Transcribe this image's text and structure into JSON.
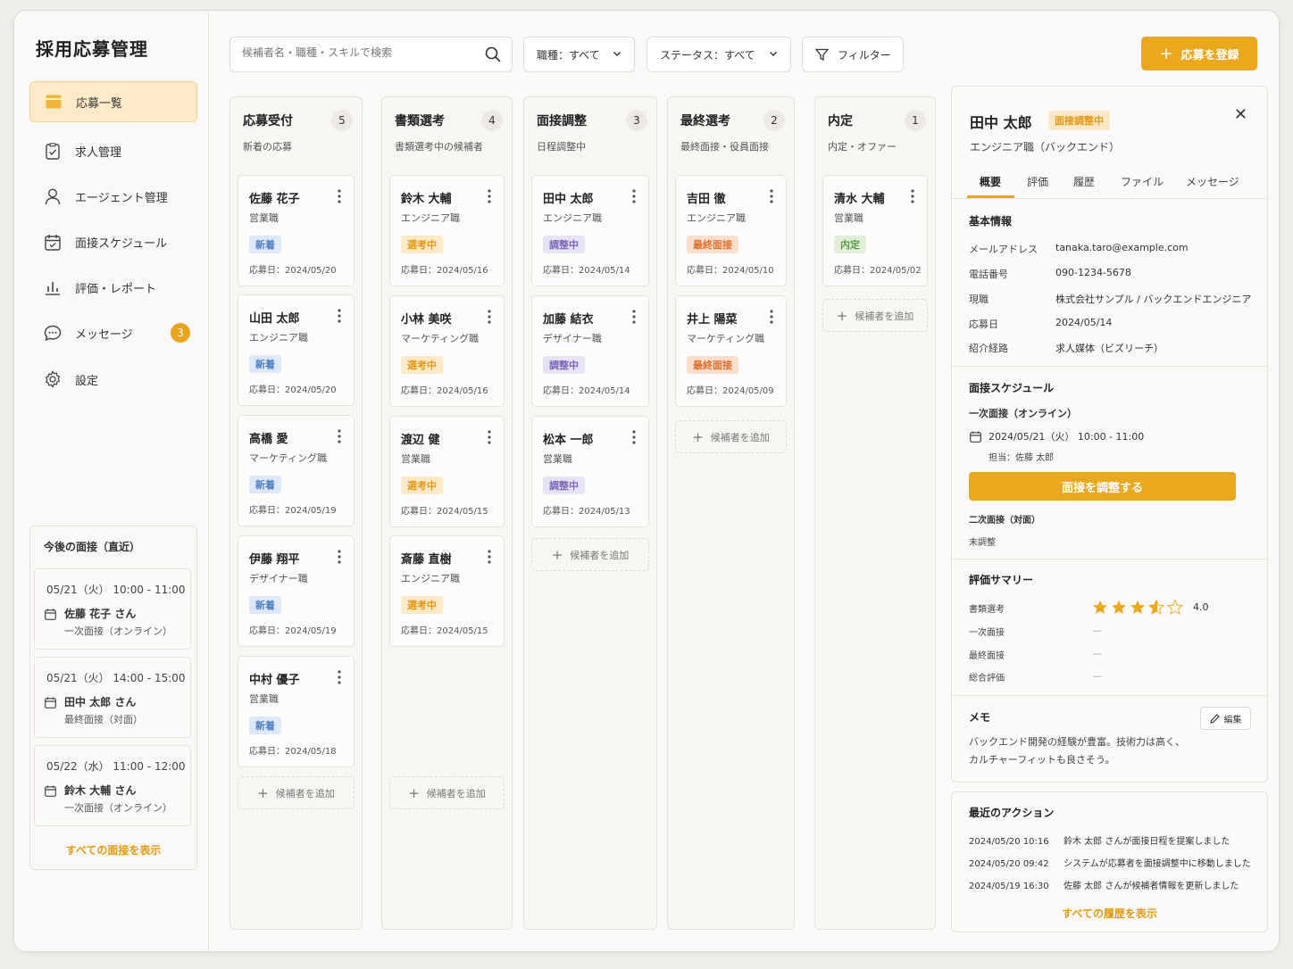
{
  "app": {
    "title": "採用応募管理"
  },
  "sidebar": {
    "items": [
      {
        "label": "応募一覧",
        "icon": "inbox-icon"
      },
      {
        "label": "求人管理",
        "icon": "clipboard-check-icon"
      },
      {
        "label": "エージェント管理",
        "icon": "user-icon"
      },
      {
        "label": "面接スケジュール",
        "icon": "calendar-check-icon"
      },
      {
        "label": "評価・レポート",
        "icon": "bar-chart-icon"
      },
      {
        "label": "メッセージ",
        "icon": "chat-icon",
        "badge": "3"
      },
      {
        "label": "設定",
        "icon": "gear-icon"
      }
    ],
    "upcoming": {
      "title": "今後の面接（直近）",
      "items": [
        {
          "time": "05/21（火） 10:00 - 11:00",
          "name": "佐藤 花子 さん",
          "type": "一次面接（オンライン）"
        },
        {
          "time": "05/21（火） 14:00 - 15:00",
          "name": "田中 太郎 さん",
          "type": "最終面接（対面）"
        },
        {
          "time": "05/22（水） 11:00 - 12:00",
          "name": "鈴木 大輔 さん",
          "type": "一次面接（オンライン）"
        }
      ],
      "link": "すべての面接を表示"
    }
  },
  "toolbar": {
    "search_placeholder": "候補者名・職種・スキルで検索",
    "job_filter": "職種：すべて",
    "status_filter": "ステータス：すべて",
    "filter_label": "フィルター",
    "add_label": "応募を登録"
  },
  "board": {
    "add_candidate": "候補者を追加",
    "columns": [
      {
        "title": "応募受付",
        "count": "5",
        "subtitle": "新着の応募",
        "cards": [
          {
            "name": "佐藤 花子",
            "role": "営業職",
            "tag": "新着",
            "tag_type": "new",
            "date": "応募日：2024/05/20"
          },
          {
            "name": "山田 太郎",
            "role": "エンジニア職",
            "tag": "新着",
            "tag_type": "new",
            "date": "応募日：2024/05/20"
          },
          {
            "name": "高橋 愛",
            "role": "マーケティング職",
            "tag": "新着",
            "tag_type": "new",
            "date": "応募日：2024/05/19"
          },
          {
            "name": "伊藤 翔平",
            "role": "デザイナー職",
            "tag": "新着",
            "tag_type": "new",
            "date": "応募日：2024/05/19"
          },
          {
            "name": "中村 優子",
            "role": "営業職",
            "tag": "新着",
            "tag_type": "new",
            "date": "応募日：2024/05/18"
          }
        ]
      },
      {
        "title": "書類選考",
        "count": "4",
        "subtitle": "書類選考中の候補者",
        "cards": [
          {
            "name": "鈴木 大輔",
            "role": "エンジニア職",
            "tag": "選考中",
            "tag_type": "sel",
            "date": "応募日：2024/05/16"
          },
          {
            "name": "小林 美咲",
            "role": "マーケティング職",
            "tag": "選考中",
            "tag_type": "sel",
            "date": "応募日：2024/05/16"
          },
          {
            "name": "渡辺 健",
            "role": "営業職",
            "tag": "選考中",
            "tag_type": "sel",
            "date": "応募日：2024/05/15"
          },
          {
            "name": "斎藤 直樹",
            "role": "エンジニア職",
            "tag": "選考中",
            "tag_type": "sel",
            "date": "応募日：2024/05/15"
          }
        ]
      },
      {
        "title": "面接調整",
        "count": "3",
        "subtitle": "日程調整中",
        "cards": [
          {
            "name": "田中 太郎",
            "role": "エンジニア職",
            "tag": "調整中",
            "tag_type": "adj",
            "date": "応募日：2024/05/14"
          },
          {
            "name": "加藤 結衣",
            "role": "デザイナー職",
            "tag": "調整中",
            "tag_type": "adj",
            "date": "応募日：2024/05/14"
          },
          {
            "name": "松本 一郎",
            "role": "営業職",
            "tag": "調整中",
            "tag_type": "adj",
            "date": "応募日：2024/05/13"
          }
        ]
      },
      {
        "title": "最終選考",
        "count": "2",
        "subtitle": "最終面接・役員面接",
        "cards": [
          {
            "name": "吉田 徹",
            "role": "エンジニア職",
            "tag": "最終面接",
            "tag_type": "fin",
            "date": "応募日：2024/05/10"
          },
          {
            "name": "井上 陽菜",
            "role": "マーケティング職",
            "tag": "最終面接",
            "tag_type": "fin",
            "date": "応募日：2024/05/09"
          }
        ]
      },
      {
        "title": "内定",
        "count": "1",
        "subtitle": "内定・オファー",
        "cards": [
          {
            "name": "清水 大輔",
            "role": "営業職",
            "tag": "内定",
            "tag_type": "off",
            "date": "応募日：2024/05/02"
          }
        ]
      }
    ]
  },
  "detail": {
    "name": "田中 太郎",
    "badge": "面接調整中",
    "role": "エンジニア職（バックエンド）",
    "tabs": [
      "概要",
      "評価",
      "履歴",
      "ファイル",
      "メッセージ"
    ],
    "basic_title": "基本情報",
    "basic": [
      {
        "k": "メールアドレス",
        "v": "tanaka.taro@example.com"
      },
      {
        "k": "電話番号",
        "v": "090-1234-5678"
      },
      {
        "k": "現職",
        "v": "株式会社サンプル / バックエンドエンジニア"
      },
      {
        "k": "応募日",
        "v": "2024/05/14"
      },
      {
        "k": "紹介経路",
        "v": "求人媒体（ビズリーチ）"
      }
    ],
    "schedule_title": "面接スケジュール",
    "first_interview": "一次面接（オンライン）",
    "first_datetime": "2024/05/21（火） 10:00 - 11:00",
    "first_owner": "担当：佐藤 太郎",
    "adjust_btn": "面接を調整する",
    "second_interview": "二次面接（対面）",
    "second_status": "未調整",
    "eval_title": "評価サマリー",
    "eval": [
      {
        "k": "書類選考",
        "v": "4.0"
      },
      {
        "k": "一次面接",
        "v": "—"
      },
      {
        "k": "最終面接",
        "v": "—"
      },
      {
        "k": "総合評価",
        "v": "—"
      }
    ],
    "rating": 4.0,
    "memo_title": "メモ",
    "edit_label": "編集",
    "memo_line1": "バックエンド開発の経験が豊富。技術力は高く、",
    "memo_line2": "カルチャーフィットも良さそう。"
  },
  "actions": {
    "title": "最近のアクション",
    "items": [
      {
        "time": "2024/05/20 10:16",
        "text": "鈴木 太郎 さんが面接日程を提案しました"
      },
      {
        "time": "2024/05/20 09:42",
        "text": "システムが応募者を面接調整中に移動しました"
      },
      {
        "time": "2024/05/19 16:30",
        "text": "佐藤 太郎 さんが候補者情報を更新しました"
      }
    ],
    "link": "すべての履歴を表示"
  },
  "colors": {
    "accent": "#eaa81f",
    "active_bg": "#fcebc6"
  }
}
